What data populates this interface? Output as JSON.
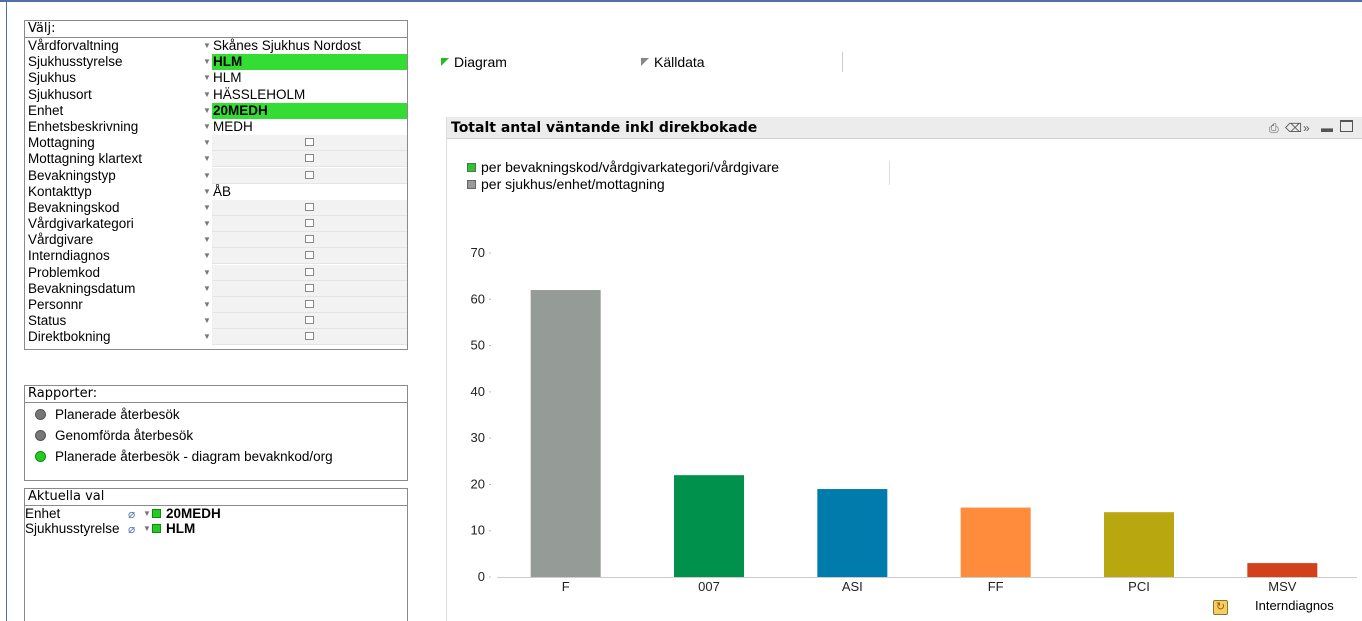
{
  "valj": {
    "title": "Välj:",
    "rows": [
      {
        "label": "Vårdforvaltning",
        "value": "Skånes Sjukhus Nordost",
        "state": "normal"
      },
      {
        "label": "Sjukhusstyrelse",
        "value": "HLM",
        "state": "selected"
      },
      {
        "label": "Sjukhus",
        "value": "HLM",
        "state": "normal"
      },
      {
        "label": "Sjukhusort",
        "value": "HÄSSLEHOLM",
        "state": "normal"
      },
      {
        "label": "Enhet",
        "value": "20MEDH",
        "state": "selected"
      },
      {
        "label": "Enhetsbeskrivning",
        "value": "MEDH",
        "state": "normal"
      },
      {
        "label": "Mottagning",
        "value": "",
        "state": "empty"
      },
      {
        "label": "Mottagning klartext",
        "value": "",
        "state": "empty"
      },
      {
        "label": "Bevakningstyp",
        "value": "",
        "state": "empty"
      },
      {
        "label": "Kontakttyp",
        "value": "ÅB",
        "state": "normal"
      },
      {
        "label": "Bevakningskod",
        "value": "",
        "state": "empty"
      },
      {
        "label": "Vårdgivarkategori",
        "value": "",
        "state": "empty"
      },
      {
        "label": "Vårdgivare",
        "value": "",
        "state": "empty"
      },
      {
        "label": "Interndiagnos",
        "value": "",
        "state": "empty"
      },
      {
        "label": "Problemkod",
        "value": "",
        "state": "empty"
      },
      {
        "label": "Bevakningsdatum",
        "value": "",
        "state": "empty"
      },
      {
        "label": "Personnr",
        "value": "",
        "state": "empty"
      },
      {
        "label": "Status",
        "value": "",
        "state": "empty"
      },
      {
        "label": "Direktbokning",
        "value": "",
        "state": "empty"
      }
    ]
  },
  "rapporter": {
    "title": "Rapporter:",
    "items": [
      {
        "label": "Planerade återbesök",
        "active": false
      },
      {
        "label": "Genomförda återbesök",
        "active": false
      },
      {
        "label": "Planerade återbesök - diagram bevaknkod/org",
        "active": true
      }
    ]
  },
  "aktuella": {
    "title": "Aktuella val",
    "rows": [
      {
        "field": "Enhet",
        "value": "20MEDH"
      },
      {
        "field": "Sjukhusstyrelse",
        "value": "HLM"
      }
    ]
  },
  "tabs": [
    {
      "label": "Diagram",
      "active": true
    },
    {
      "label": "Källdata",
      "active": false
    }
  ],
  "colors": {
    "selected": "#33dd33",
    "accent_frame": "#4f6fa6"
  },
  "chart_data": {
    "type": "bar",
    "title": "Totalt antal väntande inkl direkbokade",
    "xlabel": "Interndiagnos",
    "ylabel": "",
    "ylim": [
      0,
      70
    ],
    "yticks": [
      0,
      10,
      20,
      30,
      40,
      50,
      60,
      70
    ],
    "grid": false,
    "legend_position": "top-left",
    "legend": [
      {
        "label": "per bevakningskod/vårdgivarkategori/vårdgivare",
        "color": "#22cc22"
      },
      {
        "label": "per sjukhus/enhet/mottagning",
        "color": "#999999"
      }
    ],
    "categories": [
      "F",
      "007",
      "ASI",
      "FF",
      "PCI",
      "MSV"
    ],
    "values": [
      62,
      22,
      19,
      15,
      14,
      3
    ],
    "bar_colors": [
      "#959b96",
      "#00914d",
      "#007bab",
      "#ff8c3d",
      "#b8a70e",
      "#d2411c"
    ]
  }
}
